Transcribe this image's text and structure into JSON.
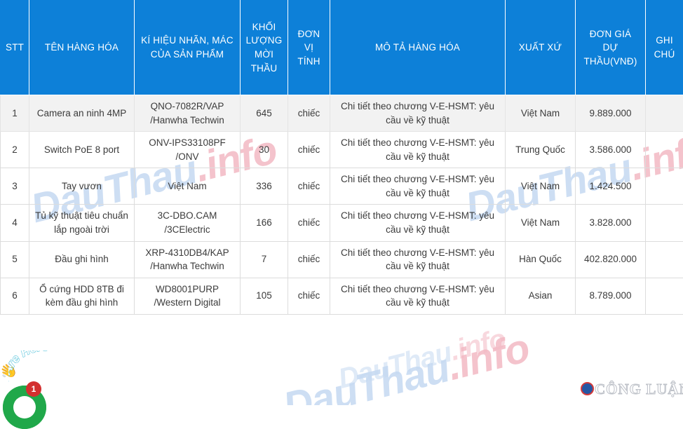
{
  "table": {
    "headers": [
      "STT",
      "TÊN HÀNG HÓA",
      "KÍ HIỆU NHÃN, MÁC CỦA SẢN PHẨM",
      "KHỐI LƯỢNG MỜI THẦU",
      "ĐƠN VỊ TÍNH",
      "MÔ TẢ HÀNG HÓA",
      "XUẤT XỨ",
      "ĐƠN GIÁ DỰ THẦU(VNĐ)",
      "GHI CHÚ"
    ],
    "rows": [
      {
        "stt": "1",
        "name": "Camera an ninh 4MP",
        "label": "QNO-7082R/VAP /Hanwha Techwin",
        "qty": "645",
        "unit": "chiếc",
        "desc": "Chi tiết theo chương V-E-HSMT: yêu cầu về kỹ thuật",
        "origin": "Việt Nam",
        "price": "9.889.000",
        "note": ""
      },
      {
        "stt": "2",
        "name": "Switch PoE 8 port",
        "label": "ONV-IPS33108PF /ONV",
        "qty": "30",
        "unit": "chiếc",
        "desc": "Chi tiết theo chương V-E-HSMT: yêu cầu về kỹ thuật",
        "origin": "Trung Quốc",
        "price": "3.586.000",
        "note": ""
      },
      {
        "stt": "3",
        "name": "Tay vươn",
        "label": "Việt Nam",
        "qty": "336",
        "unit": "chiếc",
        "desc": "Chi tiết theo chương V-E-HSMT: yêu cầu về kỹ thuật",
        "origin": "Việt Nam",
        "price": "1.424.500",
        "note": ""
      },
      {
        "stt": "4",
        "name": "Tủ kỹ thuật tiêu chuẩn lắp ngoài trời",
        "label": "3C-DBO.CAM /3CElectric",
        "qty": "166",
        "unit": "chiếc",
        "desc": "Chi tiết theo chương V-E-HSMT: yêu cầu về kỹ thuật",
        "origin": "Việt Nam",
        "price": "3.828.000",
        "note": ""
      },
      {
        "stt": "5",
        "name": "Đầu ghi hình",
        "label": "XRP-4310DB4/KAP /Hanwha Techwin",
        "qty": "7",
        "unit": "chiếc",
        "desc": "Chi tiết theo chương V-E-HSMT: yêu cầu về kỹ thuật",
        "origin": "Hàn Quốc",
        "price": "402.820.000",
        "note": ""
      },
      {
        "stt": "6",
        "name": "Ổ cứng HDD 8TB đi kèm đầu ghi hình",
        "label": "WD8001PURP /Western Digital",
        "qty": "105",
        "unit": "chiếc",
        "desc": "Chi tiết theo chương V-E-HSMT: yêu cầu về kỹ thuật",
        "origin": "Asian",
        "price": "8.789.000",
        "note": ""
      }
    ]
  },
  "watermarks": {
    "site_main": "DauThau",
    "site_suffix": ".info",
    "publisher": "CÔNG LUẬN"
  },
  "sticker": {
    "badge_count": "1",
    "hand_icon": "waving-hand-icon",
    "curve_label": "We Are Here"
  },
  "colors": {
    "header_blue": "#0d80d8",
    "row_alt": "#f2f2f2",
    "border": "#dcdcdc",
    "text": "#3b3b3b",
    "badge_red": "#d32f2f",
    "ring_green": "#20a84a",
    "watermark_blue": "#c5d9f2",
    "watermark_pink": "#f3b9c4"
  }
}
